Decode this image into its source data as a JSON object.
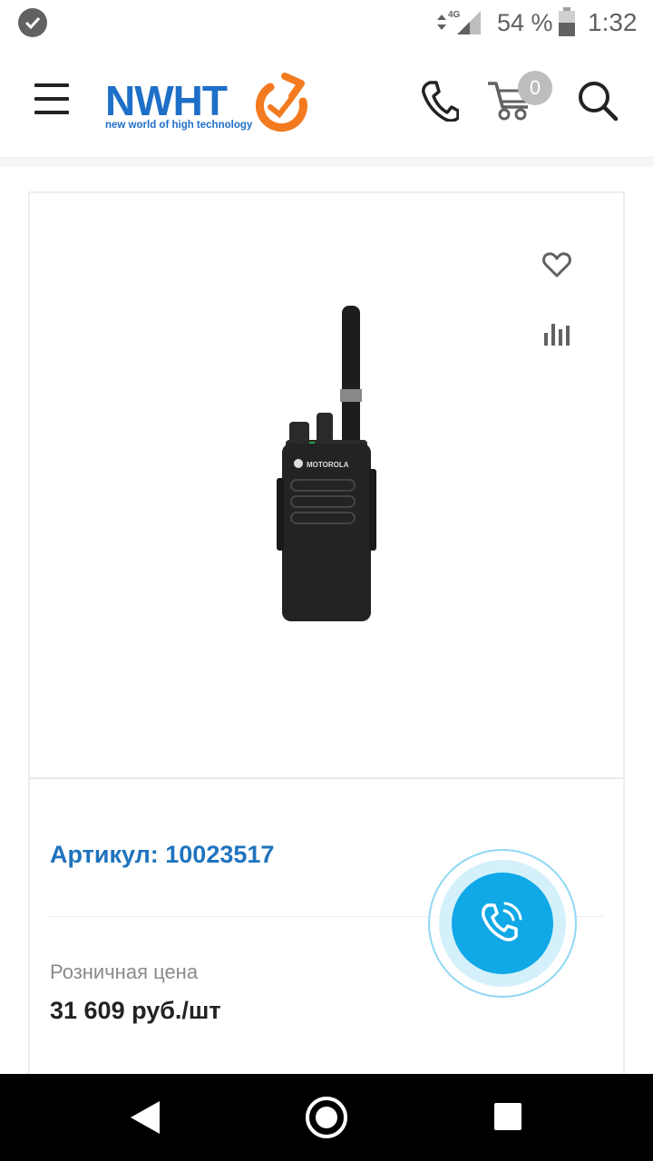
{
  "status_bar": {
    "network": "4G",
    "battery_percent": "54 %",
    "time": "1:32"
  },
  "header": {
    "logo_text": "NWHT",
    "logo_tagline": "new world of high technology",
    "cart_count": "0"
  },
  "product": {
    "image_label": "MOTOROLA",
    "article": "Артикул: 10023517",
    "price_label": "Розничная цена",
    "price_value": "31 609 руб./шт"
  },
  "colors": {
    "accent_blue": "#1e73be",
    "logo_orange": "#f47a20",
    "call_button": "#10a8e6"
  }
}
